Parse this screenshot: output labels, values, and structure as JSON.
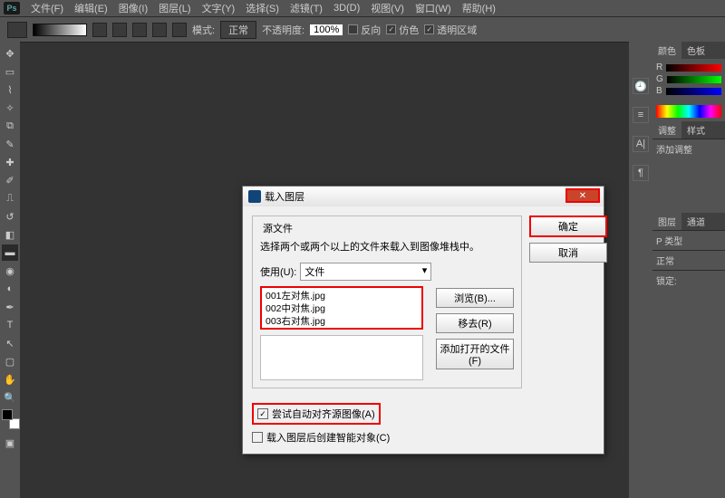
{
  "menubar": {
    "logo": "Ps",
    "items": [
      "文件(F)",
      "编辑(E)",
      "图像(I)",
      "图层(L)",
      "文字(Y)",
      "选择(S)",
      "滤镜(T)",
      "3D(D)",
      "视图(V)",
      "窗口(W)",
      "帮助(H)"
    ]
  },
  "toolbar": {
    "mode_label": "模式:",
    "mode_value": "正常",
    "opacity_label": "不透明度:",
    "opacity_value": "100%",
    "reverse": "反向",
    "dither": "仿色",
    "transparency": "透明区域"
  },
  "panels": {
    "color_tab": "颜色",
    "swatches_tab": "色板",
    "adjust_tab": "调整",
    "styles_tab": "样式",
    "add_adjust": "添加调整",
    "layers_tab": "图层",
    "channels_tab": "通道",
    "kind_label": "P 类型",
    "blend_mode": "正常",
    "lock_label": "锁定:"
  },
  "dialog": {
    "title": "载入图层",
    "group_label": "源文件",
    "group_text": "选择两个或两个以上的文件来载入到图像堆栈中。",
    "use_label": "使用(U):",
    "use_value": "文件",
    "files": [
      "001左对焦.jpg",
      "002中对焦.jpg",
      "003右对焦.jpg"
    ],
    "ok_btn": "确定",
    "cancel_btn": "取消",
    "browse_btn": "浏览(B)...",
    "remove_btn": "移去(R)",
    "addopen_btn": "添加打开的文件(F)",
    "align_chk": "尝试自动对齐源图像(A)",
    "smart_chk": "载入图层后创建智能对象(C)"
  }
}
